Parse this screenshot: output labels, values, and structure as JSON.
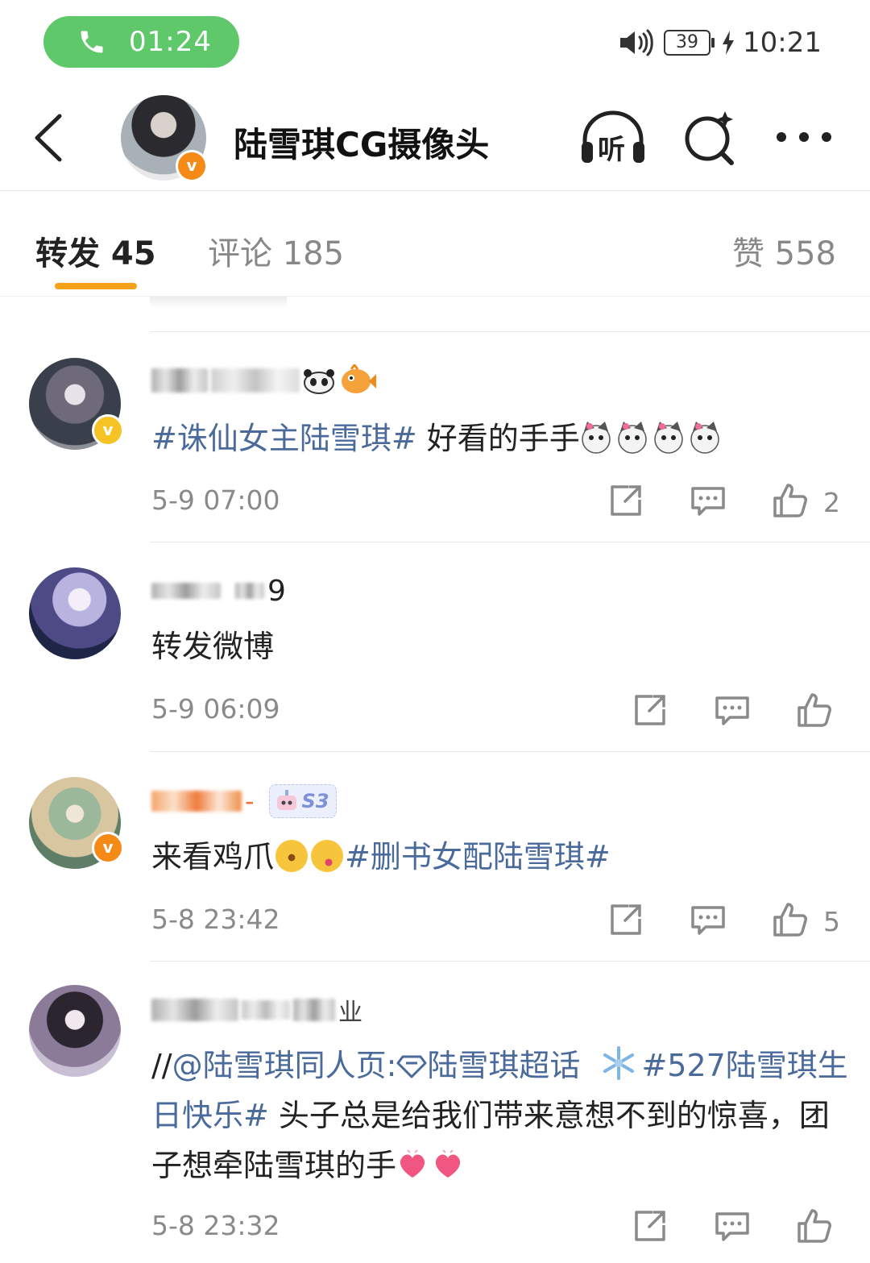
{
  "status_bar": {
    "call_time": "01:24",
    "battery": "39",
    "clock": "10:21"
  },
  "header": {
    "title": "陆雪琪CG摄像头",
    "listen_glyph": "听",
    "badge": "v"
  },
  "tabs": {
    "repost": "转发 45",
    "comments": "评论 185",
    "likes": "赞 558"
  },
  "posts": [
    {
      "name_suffix": "",
      "topic": "#诛仙女主陆雪琪#",
      "text": " 好看的手手",
      "time": "5-9 07:00",
      "like_count": "2",
      "verified": "v"
    },
    {
      "name_suffix": "9",
      "text": "转发微博",
      "time": "5-9 06:09",
      "like_count": ""
    },
    {
      "name_suffix": "-",
      "level_badge": "S3",
      "text": "来看鸡爪",
      "topic": "#删书女配陆雪琪#",
      "time": "5-8 23:42",
      "like_count": "5",
      "verified": "v"
    },
    {
      "name_suffix": "业",
      "text_prefix": "//",
      "mention": "@陆雪琪同人页:",
      "supertopic": "陆雪琪超话",
      "topic": "#527陆雪琪生日快乐#",
      "text": " 头子总是给我们带来意想不到的惊喜，团子想牵陆雪琪的手",
      "time": "5-8 23:32",
      "like_count": ""
    }
  ],
  "icons": {
    "call": "phone-icon",
    "volume": "volume-icon",
    "charging": "bolt-icon",
    "back": "back-arrow-icon",
    "listen": "headphones-icon",
    "search": "search-icon",
    "more": "more-icon",
    "share": "share-icon",
    "comment": "comment-icon",
    "like": "thumbs-up-icon"
  },
  "colors": {
    "call_pill": "#5fc86a",
    "tab_underline": "#f7a11b",
    "topic": "#4a6a9c",
    "verified": "#f58a17"
  }
}
